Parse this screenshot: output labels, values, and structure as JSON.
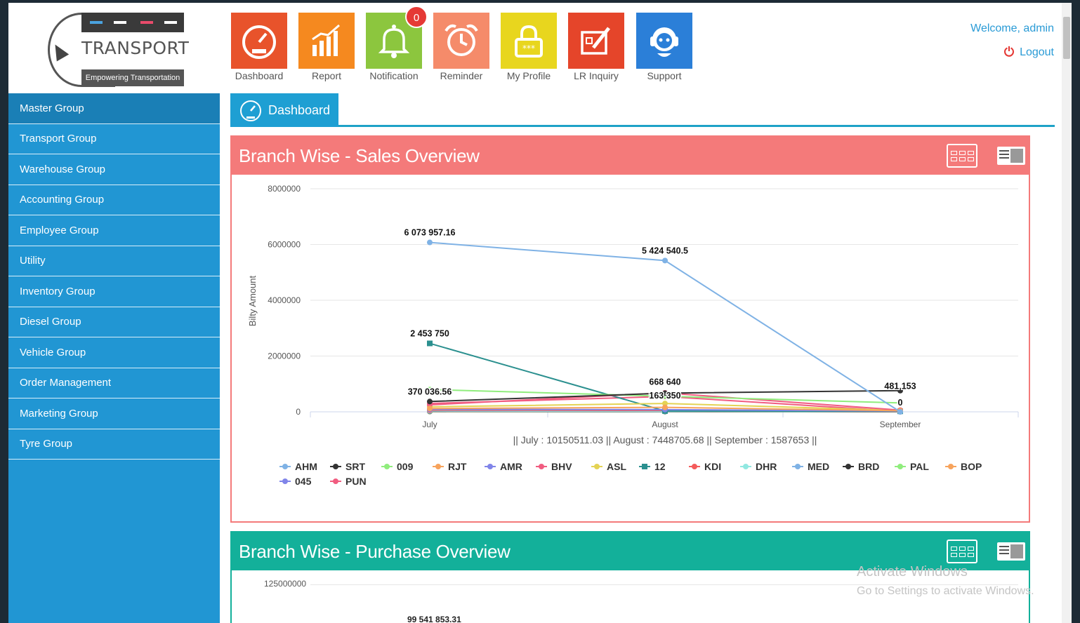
{
  "logo": {
    "text": "TRANSPORT",
    "tagline": "Empowering Transportation"
  },
  "sidebar": {
    "items": [
      {
        "label": "Master Group"
      },
      {
        "label": "Transport Group"
      },
      {
        "label": "Warehouse Group"
      },
      {
        "label": "Accounting Group"
      },
      {
        "label": "Employee Group"
      },
      {
        "label": "Utility"
      },
      {
        "label": "Inventory Group"
      },
      {
        "label": "Diesel Group"
      },
      {
        "label": "Vehicle Group"
      },
      {
        "label": "Order Management"
      },
      {
        "label": "Marketing Group"
      },
      {
        "label": "Tyre Group"
      }
    ]
  },
  "topnav": {
    "tiles": [
      {
        "label": "Dashboard",
        "color": "#e8532b",
        "icon": "speedometer-icon"
      },
      {
        "label": "Report",
        "color": "#f5891f",
        "icon": "bar-chart-icon"
      },
      {
        "label": "Notification",
        "color": "#8cc63e",
        "icon": "bell-icon",
        "badge": "0"
      },
      {
        "label": "Reminder",
        "color": "#f58b6a",
        "icon": "alarm-clock-icon"
      },
      {
        "label": "My Profile",
        "color": "#e8d61e",
        "icon": "lock-icon"
      },
      {
        "label": "LR Inquiry",
        "color": "#e5452a",
        "icon": "edit-document-icon"
      },
      {
        "label": "Support",
        "color": "#2b7fd8",
        "icon": "headset-icon"
      }
    ]
  },
  "header": {
    "welcome": "Welcome, admin",
    "logout": "Logout"
  },
  "tab": {
    "label": "Dashboard"
  },
  "sales_panel": {
    "title": "Branch Wise - Sales Overview",
    "color": "#f47a7a"
  },
  "purchase_panel": {
    "title": "Branch Wise - Purchase Overview",
    "color": "#13b09a",
    "first_tick": "125000000",
    "first_label": "99 541 853.31"
  },
  "watermark": {
    "line1": "Activate Windows",
    "line2": "Go to Settings to activate Windows."
  },
  "chart_data": {
    "type": "line",
    "title": "Branch Wise - Sales Overview",
    "ylabel": "Bilty Amount",
    "xlabel": "|| July : 10150511.03 || August : 7448705.68 || September : 1587653 ||",
    "categories": [
      "July",
      "August",
      "September"
    ],
    "ylim": [
      0,
      8000000
    ],
    "yticks": [
      "8000000",
      "6000000",
      "4000000",
      "2000000",
      "0"
    ],
    "grid": true,
    "legend_position": "bottom",
    "series": [
      {
        "name": "AHM",
        "color": "#7fb2e5",
        "values": [
          6073957.16,
          5424540.5,
          0
        ],
        "labels": [
          "6 073 957.16",
          "5 424 540.5",
          ""
        ]
      },
      {
        "name": "SRT",
        "color": "#333333",
        "values": [
          370036.56,
          668640,
          761153
        ],
        "labels": [
          "",
          "668 640",
          "481 153"
        ]
      },
      {
        "name": "009",
        "color": "#90ed7d",
        "values": [
          800000,
          560000,
          320000
        ],
        "labels": [
          "370 036.56",
          "",
          ""
        ]
      },
      {
        "name": "RJT",
        "color": "#f7a35c",
        "values": [
          120000,
          160000,
          40000
        ],
        "labels": [
          "",
          "",
          ""
        ]
      },
      {
        "name": "AMR",
        "color": "#8085e9",
        "values": [
          90000,
          80000,
          30000
        ],
        "labels": [
          "",
          "",
          ""
        ]
      },
      {
        "name": "BHV",
        "color": "#f15c80",
        "values": [
          250000,
          680000,
          60000
        ],
        "labels": [
          "",
          "163 350",
          "0"
        ]
      },
      {
        "name": "ASL",
        "color": "#e4d354",
        "values": [
          180000,
          300000,
          50000
        ],
        "labels": [
          "",
          "",
          ""
        ]
      },
      {
        "name": "12",
        "color": "#2b908f",
        "values": [
          2453750,
          30000,
          20000
        ],
        "labels": [
          "2 453 750",
          "",
          ""
        ]
      },
      {
        "name": "KDI",
        "color": "#f45b5b",
        "values": [
          60000,
          50000,
          10000
        ],
        "labels": [
          "",
          "",
          ""
        ]
      },
      {
        "name": "DHR",
        "color": "#91e8e1",
        "values": [
          40000,
          30000,
          10000
        ],
        "labels": [
          "",
          "",
          ""
        ]
      },
      {
        "name": "MED",
        "color": "#7fb2e5",
        "values": [
          30000,
          20000,
          8000
        ],
        "labels": [
          "",
          "",
          ""
        ]
      },
      {
        "name": "BRD",
        "color": "#333333",
        "values": [
          20000,
          15000,
          6000
        ],
        "labels": [
          "",
          "",
          ""
        ]
      },
      {
        "name": "PAL",
        "color": "#90ed7d",
        "values": [
          15000,
          10000,
          5000
        ],
        "labels": [
          "",
          "",
          ""
        ]
      },
      {
        "name": "BOP",
        "color": "#f7a35c",
        "values": [
          10000,
          8000,
          4000
        ],
        "labels": [
          "",
          "",
          ""
        ]
      },
      {
        "name": "045",
        "color": "#8085e9",
        "values": [
          8000,
          6000,
          3000
        ],
        "labels": [
          "",
          "",
          ""
        ]
      },
      {
        "name": "PUN",
        "color": "#f15c80",
        "values": [
          300000,
          550000,
          20000
        ],
        "labels": [
          "",
          "",
          ""
        ]
      }
    ]
  }
}
